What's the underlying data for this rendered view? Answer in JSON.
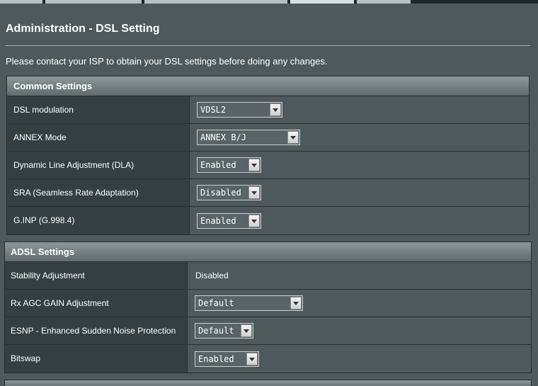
{
  "page": {
    "title": "Administration - DSL Setting",
    "notice": "Please contact your ISP to obtain your DSL settings before doing any changes."
  },
  "common": {
    "header": "Common Settings",
    "rows": [
      {
        "label": "DSL modulation",
        "value": "VDSL2"
      },
      {
        "label": "ANNEX Mode",
        "value": "ANNEX B/J"
      },
      {
        "label": "Dynamic Line Adjustment (DLA)",
        "value": "Enabled"
      },
      {
        "label": "SRA (Seamless Rate Adaptation)",
        "value": "Disabled"
      },
      {
        "label": "G.INP (G.998.4)",
        "value": "Enabled"
      }
    ]
  },
  "adsl": {
    "header": "ADSL Settings",
    "rows": [
      {
        "label": "Stability Adjustment",
        "value": "Disabled"
      },
      {
        "label": "Rx AGC GAIN Adjustment",
        "value": "Default"
      },
      {
        "label": "ESNP - Enhanced Sudden Noise Protection",
        "value": "Default"
      },
      {
        "label": "Bitswap",
        "value": "Enabled"
      }
    ]
  },
  "colors": {
    "background": "#4d595d",
    "label_cell": "#353f43",
    "header_gradient_top": "#8c979b"
  }
}
